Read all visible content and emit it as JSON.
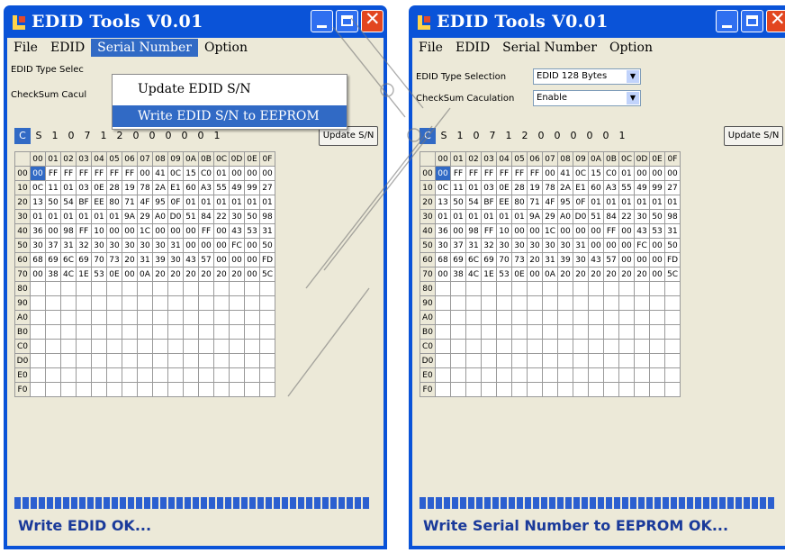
{
  "win1": {
    "title": "EDID Tools V0.01",
    "menu": [
      "File",
      "EDID",
      "Serial Number",
      "Option"
    ],
    "active_menu_index": 2,
    "dropdown": [
      "Update EDID S/N",
      "Write EDID S/N to EEPROM"
    ],
    "type_label": "EDID Type Selec",
    "checksum_label": "CheckSum Cacul",
    "serial_cells": [
      "C",
      "S",
      "1",
      "0",
      "7",
      "1",
      "2",
      "0",
      "0",
      "0",
      "0",
      "0",
      "1"
    ],
    "update_button": "Update S/N",
    "status": "Write EDID OK..."
  },
  "win2": {
    "title": "EDID Tools V0.01",
    "menu": [
      "File",
      "EDID",
      "Serial Number",
      "Option"
    ],
    "type_label": "EDID Type Selection",
    "type_value": "EDID 128 Bytes",
    "checksum_label": "CheckSum Caculation",
    "checksum_value": "Enable",
    "serial_cells": [
      "C",
      "S",
      "1",
      "0",
      "7",
      "1",
      "2",
      "0",
      "0",
      "0",
      "0",
      "0",
      "1"
    ],
    "update_button": "Update S/N",
    "status": "Write Serial Number to EEPROM OK..."
  },
  "grid": {
    "col_headers": [
      "00",
      "01",
      "02",
      "03",
      "04",
      "05",
      "06",
      "07",
      "08",
      "09",
      "0A",
      "0B",
      "0C",
      "0D",
      "0E",
      "0F"
    ],
    "row_headers": [
      "00",
      "10",
      "20",
      "30",
      "40",
      "50",
      "60",
      "70",
      "80",
      "90",
      "A0",
      "B0",
      "C0",
      "D0",
      "E0",
      "F0"
    ],
    "rows": [
      [
        "00",
        "FF",
        "FF",
        "FF",
        "FF",
        "FF",
        "FF",
        "00",
        "41",
        "0C",
        "15",
        "C0",
        "01",
        "00",
        "00",
        "00"
      ],
      [
        "0C",
        "11",
        "01",
        "03",
        "0E",
        "28",
        "19",
        "78",
        "2A",
        "E1",
        "60",
        "A3",
        "55",
        "49",
        "99",
        "27"
      ],
      [
        "13",
        "50",
        "54",
        "BF",
        "EE",
        "80",
        "71",
        "4F",
        "95",
        "0F",
        "01",
        "01",
        "01",
        "01",
        "01",
        "01"
      ],
      [
        "01",
        "01",
        "01",
        "01",
        "01",
        "01",
        "9A",
        "29",
        "A0",
        "D0",
        "51",
        "84",
        "22",
        "30",
        "50",
        "98"
      ],
      [
        "36",
        "00",
        "98",
        "FF",
        "10",
        "00",
        "00",
        "1C",
        "00",
        "00",
        "00",
        "FF",
        "00",
        "43",
        "53",
        "31"
      ],
      [
        "30",
        "37",
        "31",
        "32",
        "30",
        "30",
        "30",
        "30",
        "30",
        "31",
        "00",
        "00",
        "00",
        "FC",
        "00",
        "50"
      ],
      [
        "68",
        "69",
        "6C",
        "69",
        "70",
        "73",
        "20",
        "31",
        "39",
        "30",
        "43",
        "57",
        "00",
        "00",
        "00",
        "FD"
      ],
      [
        "00",
        "38",
        "4C",
        "1E",
        "53",
        "0E",
        "00",
        "0A",
        "20",
        "20",
        "20",
        "20",
        "20",
        "20",
        "00",
        "5C"
      ],
      [
        "",
        "",
        "",
        "",
        "",
        "",
        "",
        "",
        "",
        "",
        "",
        "",
        "",
        "",
        "",
        ""
      ],
      [
        "",
        "",
        "",
        "",
        "",
        "",
        "",
        "",
        "",
        "",
        "",
        "",
        "",
        "",
        "",
        ""
      ],
      [
        "",
        "",
        "",
        "",
        "",
        "",
        "",
        "",
        "",
        "",
        "",
        "",
        "",
        "",
        "",
        ""
      ],
      [
        "",
        "",
        "",
        "",
        "",
        "",
        "",
        "",
        "",
        "",
        "",
        "",
        "",
        "",
        "",
        ""
      ],
      [
        "",
        "",
        "",
        "",
        "",
        "",
        "",
        "",
        "",
        "",
        "",
        "",
        "",
        "",
        "",
        ""
      ],
      [
        "",
        "",
        "",
        "",
        "",
        "",
        "",
        "",
        "",
        "",
        "",
        "",
        "",
        "",
        "",
        ""
      ],
      [
        "",
        "",
        "",
        "",
        "",
        "",
        "",
        "",
        "",
        "",
        "",
        "",
        "",
        "",
        "",
        ""
      ],
      [
        "",
        "",
        "",
        "",
        "",
        "",
        "",
        "",
        "",
        "",
        "",
        "",
        "",
        "",
        "",
        ""
      ]
    ]
  },
  "progress_fraction": 1.0,
  "colors": {
    "titlebar": "#0a53d8",
    "highlight": "#316ac5",
    "close": "#e2461f",
    "status_text": "#1a3a9a"
  }
}
